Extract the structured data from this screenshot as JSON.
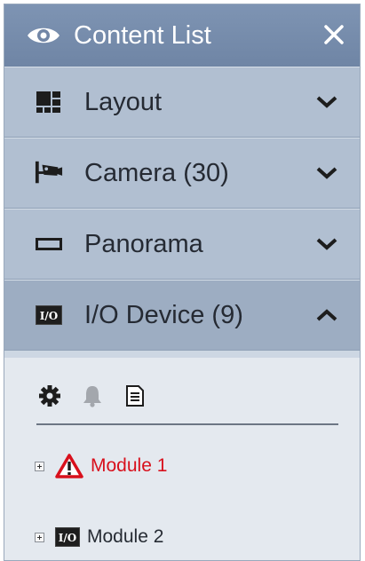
{
  "panel": {
    "title": "Content List",
    "title_icon": "eye-icon",
    "close_icon": "close-icon"
  },
  "sections": [
    {
      "label": "Layout",
      "icon": "layout-grid-icon",
      "expanded": false
    },
    {
      "label": "Camera (30)",
      "icon": "camera-icon",
      "expanded": false
    },
    {
      "label": "Panorama",
      "icon": "panorama-icon",
      "expanded": false
    },
    {
      "label": "I/O Device (9)",
      "icon": "io-device-icon",
      "expanded": true
    }
  ],
  "io_badge_text": "I/O",
  "toolbar": {
    "items": [
      {
        "icon": "settings-gear-icon",
        "enabled": true
      },
      {
        "icon": "bell-icon",
        "enabled": false
      },
      {
        "icon": "list-document-icon",
        "enabled": true
      }
    ]
  },
  "tree": [
    {
      "label": "Module 1",
      "icon": "warning-triangle-icon",
      "status": "alarm"
    },
    {
      "label": "Module 2",
      "icon": "io-device-icon",
      "status": "normal"
    }
  ],
  "colors": {
    "titlebar": "#7890ae",
    "section": "#b1bfd1",
    "alarm_text": "#d8101c",
    "content_bg": "#e4e9ef"
  }
}
